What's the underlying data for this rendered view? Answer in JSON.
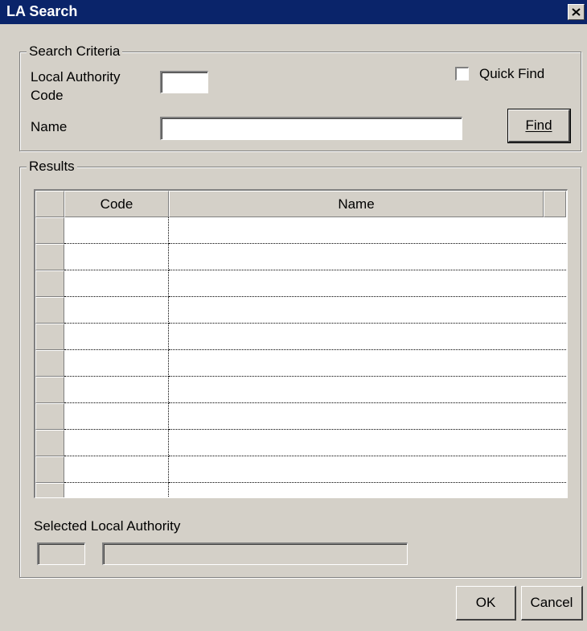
{
  "window": {
    "title": "LA Search",
    "close_icon": "close-x-icon"
  },
  "search_criteria": {
    "legend": "Search Criteria",
    "la_code_label_line1": "Local Authority",
    "la_code_label_line2": "Code",
    "la_code_value": "",
    "name_label": "Name",
    "name_value": "",
    "quick_find_label": "Quick Find",
    "quick_find_checked": false,
    "find_button": "Find"
  },
  "results": {
    "legend": "Results",
    "columns": [
      "Code",
      "Name"
    ],
    "rows": [
      {
        "code": "",
        "name": ""
      },
      {
        "code": "",
        "name": ""
      },
      {
        "code": "",
        "name": ""
      },
      {
        "code": "",
        "name": ""
      },
      {
        "code": "",
        "name": ""
      },
      {
        "code": "",
        "name": ""
      },
      {
        "code": "",
        "name": ""
      },
      {
        "code": "",
        "name": ""
      },
      {
        "code": "",
        "name": ""
      },
      {
        "code": "",
        "name": ""
      },
      {
        "code": "",
        "name": ""
      }
    ],
    "selected_label": "Selected Local Authority",
    "selected_code": "",
    "selected_name": ""
  },
  "buttons": {
    "ok": "OK",
    "cancel": "Cancel"
  }
}
